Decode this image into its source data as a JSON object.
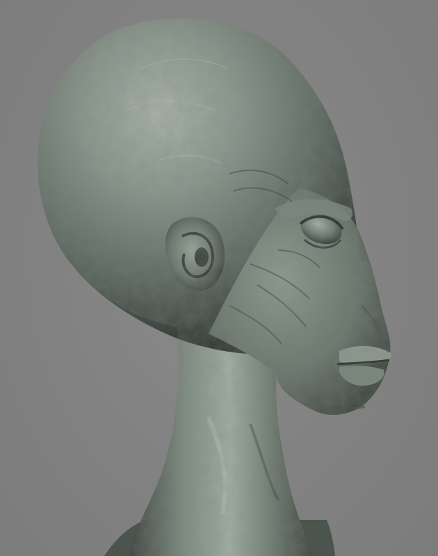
{
  "scene": {
    "subject": "",
    "background_color": "#838383",
    "material_base_color": "#5f6a62",
    "material_highlight_color": "#aab4ab",
    "material_shadow_color": "#2b312d"
  }
}
